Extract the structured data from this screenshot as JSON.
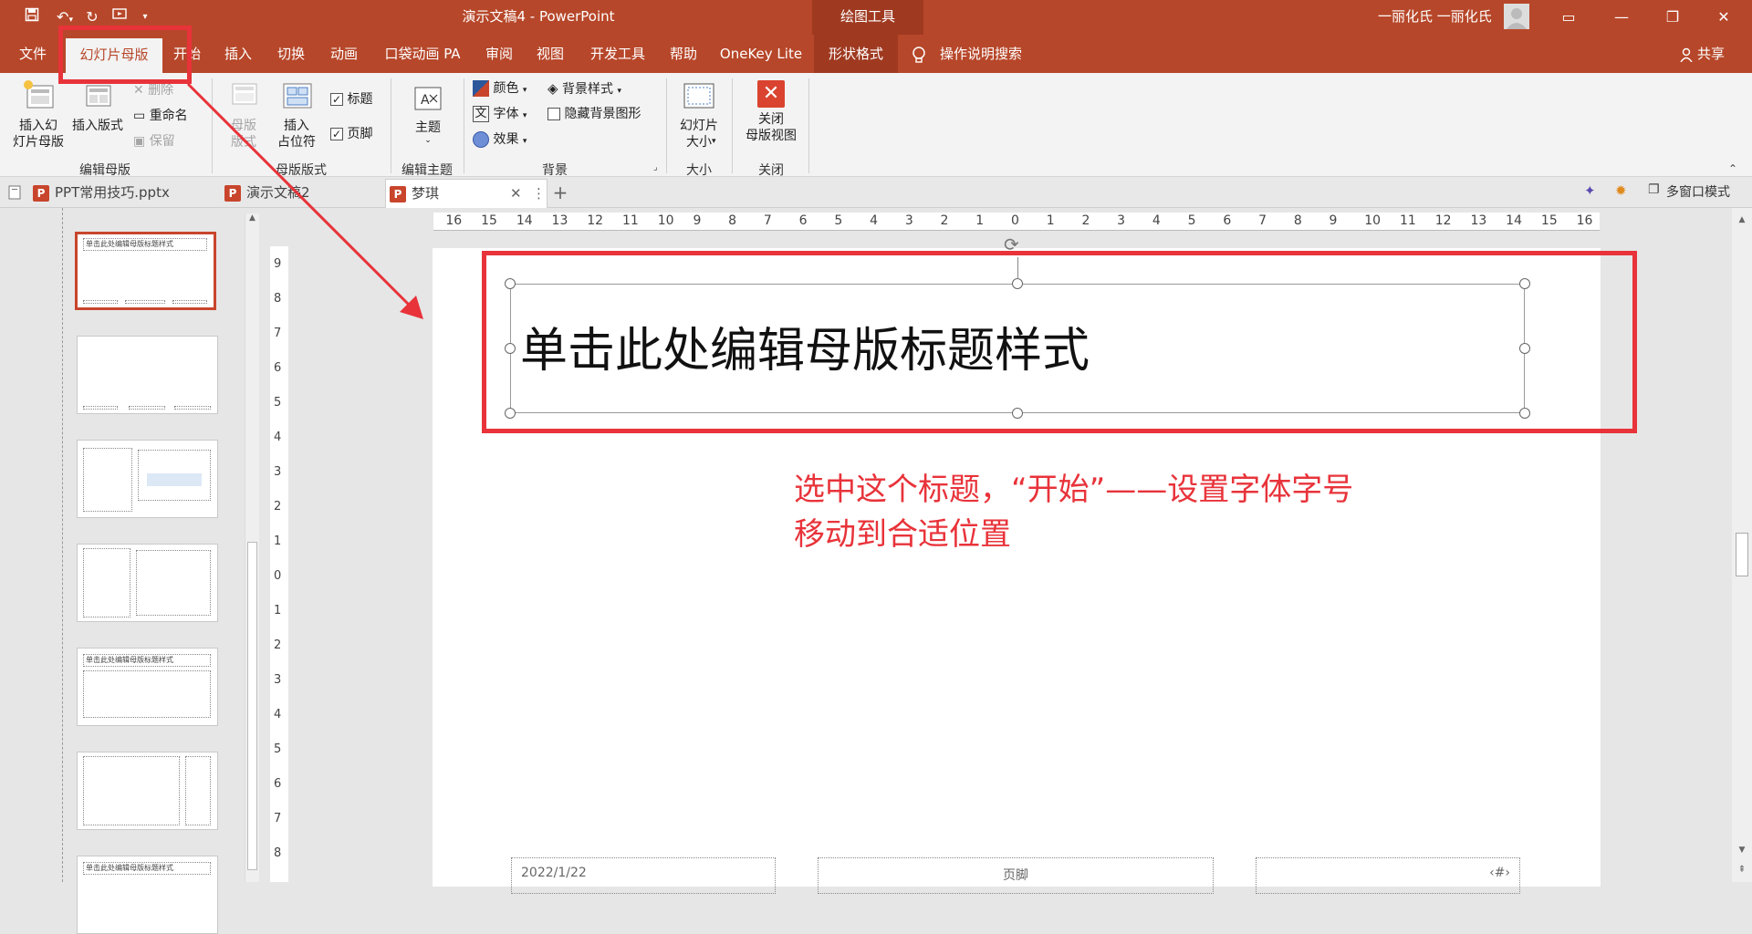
{
  "titlebar": {
    "title": "演示文稿4 - PowerPoint",
    "context_tab": "绘图工具",
    "user": "一丽化氏 一丽化氏"
  },
  "ribbon_tabs": [
    "文件",
    "幻灯片母版",
    "开始",
    "插入",
    "切换",
    "动画",
    "口袋动画 PA",
    "审阅",
    "视图",
    "开发工具",
    "帮助",
    "OneKey Lite",
    "形状格式"
  ],
  "search_label": "操作说明搜索",
  "share_label": "共享",
  "groups": {
    "edit_master": {
      "label": "编辑母版",
      "insert_master": "插入幻\n灯片母版",
      "insert_layout": "插入版式",
      "delete": "删除",
      "rename": "重命名",
      "preserve": "保留"
    },
    "master_layout": {
      "label": "母版版式",
      "layout": "母版\n版式",
      "insert_placeholder": "插入\n占位符",
      "title_check": "标题",
      "footer_check": "页脚"
    },
    "edit_theme": {
      "label": "编辑主题",
      "theme": "主题"
    },
    "background": {
      "label": "背景",
      "colors": "颜色",
      "fonts": "字体",
      "effects": "效果",
      "bg_styles": "背景样式",
      "hide_bg": "隐藏背景图形"
    },
    "size": {
      "label": "大小",
      "slide_size": "幻灯片\n大小"
    },
    "close": {
      "label": "关闭",
      "close_master": "关闭\n母版视图"
    }
  },
  "doc_tabs": [
    "PPT常用技巧.pptx",
    "演示文稿2",
    "梦琪"
  ],
  "multi_window": "多窗口模式",
  "hruler_ticks": [
    "16",
    "15",
    "14",
    "13",
    "12",
    "11",
    "10",
    "9",
    "8",
    "7",
    "6",
    "5",
    "4",
    "3",
    "2",
    "1",
    "0",
    "1",
    "2",
    "3",
    "4",
    "5",
    "6",
    "7",
    "8",
    "9",
    "10",
    "11",
    "12",
    "13",
    "14",
    "15",
    "16"
  ],
  "vruler_ticks": [
    "9",
    "8",
    "7",
    "6",
    "5",
    "4",
    "3",
    "2",
    "1",
    "0",
    "1",
    "2",
    "3",
    "4",
    "5",
    "6",
    "7",
    "8"
  ],
  "slide": {
    "title_placeholder": "单击此处编辑母版标题样式",
    "annotation_line1": "选中这个标题，“开始”——设置字体字号",
    "annotation_line2": "移动到合适位置",
    "footer_date": "2022/1/22",
    "footer_text": "页脚",
    "footer_num": "‹#›"
  },
  "thumbs": {
    "title_text": "单击此处编辑母版标题样式"
  },
  "colors": {
    "accent": "#b7472a",
    "annotation": "#e8333a"
  }
}
